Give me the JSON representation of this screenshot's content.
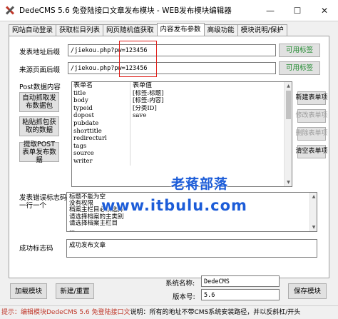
{
  "window": {
    "title": "DedeCMS 5.6 免登陆接口文章发布模块 - WEB发布模块编辑器",
    "minimize": "—",
    "maximize": "☐",
    "close": "✕"
  },
  "tabs": [
    {
      "label": "网站自动登录"
    },
    {
      "label": "获取栏目列表"
    },
    {
      "label": "网页随机值获取"
    },
    {
      "label": "内容发布参数"
    },
    {
      "label": "高级功能"
    },
    {
      "label": "模块说明/保护"
    }
  ],
  "publish_url": {
    "label": "发表地址后缀",
    "value": "/jiekou.php?pw=123456",
    "button": "可用标签"
  },
  "source_page": {
    "label": "来源页面后缀",
    "value": "/jiekou.php?pw=123456",
    "button": "可用标签"
  },
  "post_data": {
    "label": "Post数据内容",
    "btn_auto": "自动抓取发布数据包",
    "btn_paste": "粘贴抓包获取的数据",
    "btn_extract": "提取POST表单发布数据",
    "table": {
      "col_name": "表单名",
      "col_value": "表单值",
      "rows": [
        {
          "name": "title",
          "value": "[标签:标题]"
        },
        {
          "name": "body",
          "value": "[标签:内容]"
        },
        {
          "name": "typeid",
          "value": "[分类ID]"
        },
        {
          "name": "dopost",
          "value": "save"
        },
        {
          "name": "pubdate",
          "value": ""
        },
        {
          "name": "shorttitle",
          "value": ""
        },
        {
          "name": "redirecturl",
          "value": ""
        },
        {
          "name": "tags",
          "value": ""
        },
        {
          "name": "source",
          "value": ""
        },
        {
          "name": "writer",
          "value": ""
        }
      ]
    },
    "btn_new": "新建表单项",
    "btn_edit": "修改表单项",
    "btn_delete": "删除表单项",
    "btn_clear": "清空表单项"
  },
  "error_text": {
    "label": "发表错误标志码\n一行一个",
    "lines": [
      "标题不能为空",
      "没有权限",
      "档案主栏目必须选择",
      "请选择档案的主类别",
      "请选择档案主栏目",
      "..."
    ]
  },
  "success_text": {
    "label": "成功标志码",
    "value": "成功发布文章"
  },
  "footer": {
    "btn_load": "加载模块",
    "btn_new_reset": "新建/重置",
    "system_name_label": "系统名称:",
    "system_name": "DedeCMS",
    "version_label": "版本号:",
    "version": "5.6",
    "btn_save": "保存模块"
  },
  "status": {
    "prefix": "提示：编辑模块DedeCMS 5.6 免登陆接口文",
    "rest": "说明：所有的地址不带CMS系统安装路径，并以反斜杠/开头"
  },
  "watermark": {
    "line1": "老蒋部落",
    "line2": "www.itbulu.com"
  }
}
